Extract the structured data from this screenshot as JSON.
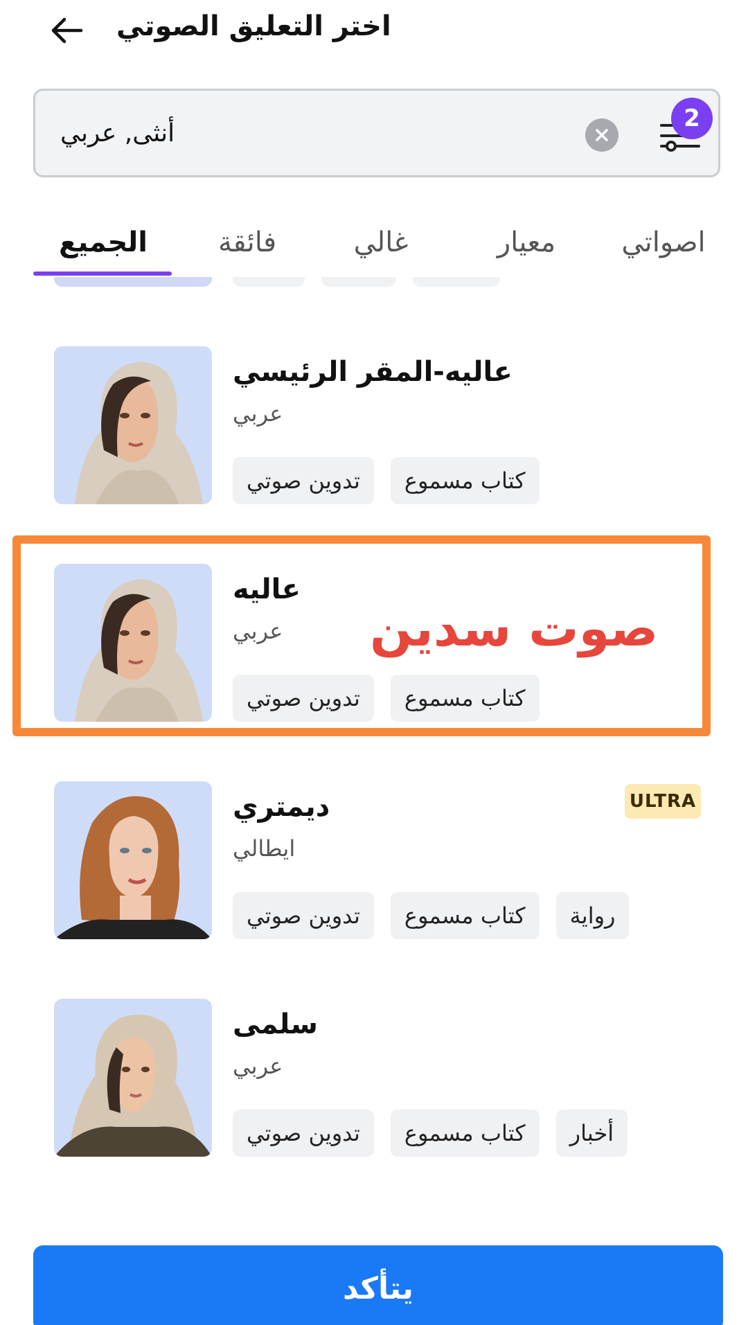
{
  "header": {
    "title": "اختر التعليق الصوتي",
    "back_icon": "arrow-left-icon"
  },
  "search": {
    "value": "أنثى, عربي",
    "clear_icon": "close-circle-icon",
    "filter_icon": "sliders-icon",
    "filter_count": "2"
  },
  "tabs": [
    {
      "label": "الجميع",
      "active": true
    },
    {
      "label": "فائقة",
      "active": false
    },
    {
      "label": "غالي",
      "active": false
    },
    {
      "label": "معيار",
      "active": false
    },
    {
      "label": "اصواتي",
      "active": false
    }
  ],
  "voices": [
    {
      "name": "عاليه-المقر الرئيسي",
      "language": "عربي",
      "tags": [
        "كتاب مسموع",
        "تدوين صوتي"
      ],
      "badge": ""
    },
    {
      "name": "عاليه",
      "language": "عربي",
      "tags": [
        "كتاب مسموع",
        "تدوين صوتي"
      ],
      "badge": ""
    },
    {
      "name": "ديمتري",
      "language": "ايطالي",
      "tags": [
        "رواية",
        "كتاب مسموع",
        "تدوين صوتي"
      ],
      "badge": "ULTRA"
    },
    {
      "name": "سلمى",
      "language": "عربي",
      "tags": [
        "أخبار",
        "كتاب مسموع",
        "تدوين صوتي"
      ],
      "badge": ""
    }
  ],
  "annotation": {
    "text": "صوت سدين",
    "color": "#e6463b",
    "box_color": "#f7883a"
  },
  "confirm": {
    "label": "يتأكد"
  },
  "colors": {
    "accent": "#7b3ff2",
    "primary_button": "#1a79f4",
    "ultra_badge": "#fde9b3"
  }
}
